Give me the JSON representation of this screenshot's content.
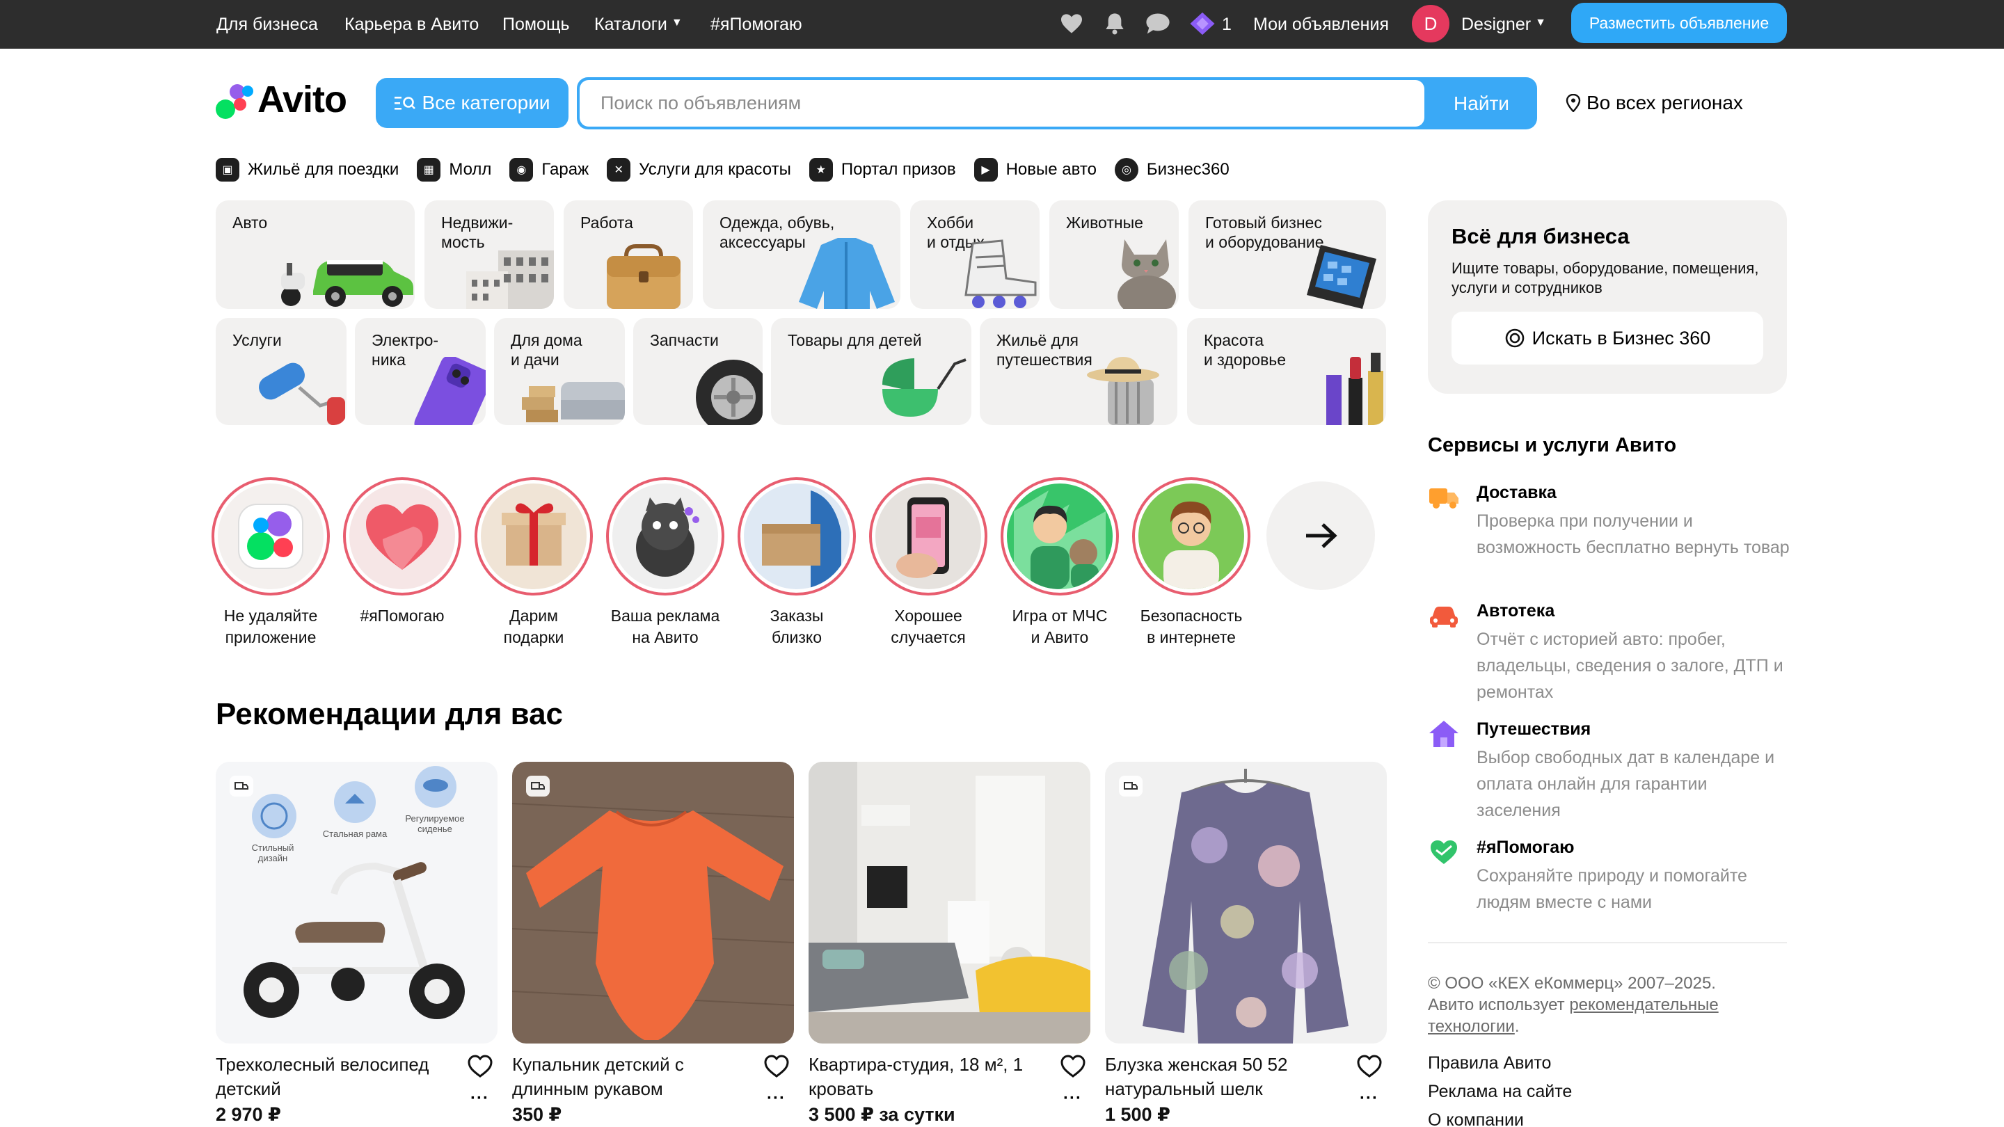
{
  "topbar": {
    "links": [
      "Для бизнеса",
      "Карьера в Авито",
      "Помощь",
      "Каталоги",
      "#яПомогаю"
    ],
    "favorites_icon": "heart-icon",
    "notifications_icon": "bell-icon",
    "messages_icon": "chat-icon",
    "promo_icon": "diamond-icon",
    "promo_count": "1",
    "my_ads": "Мои объявления",
    "avatar_letter": "D",
    "user_name": "Designer",
    "post_ad": "Разместить объявление"
  },
  "header": {
    "logo_text": "Avito",
    "all_categories": "Все категории",
    "search_placeholder": "Поиск по объявлениям",
    "search_button": "Найти",
    "region": "Во всех регионах"
  },
  "quick_links": [
    {
      "label": "Жильё для поездки",
      "icon": "suitcase-icon"
    },
    {
      "label": "Молл",
      "icon": "mall-icon"
    },
    {
      "label": "Гараж",
      "icon": "car-icon"
    },
    {
      "label": "Услуги для красоты",
      "icon": "scissors-icon"
    },
    {
      "label": "Портал призов",
      "icon": "prize-icon"
    },
    {
      "label": "Новые авто",
      "icon": "new-car-icon"
    },
    {
      "label": "Бизнес360",
      "icon": "business360-icon"
    }
  ],
  "categories": [
    {
      "label": "Авто"
    },
    {
      "label": "Недвижи-\nмость"
    },
    {
      "label": "Работа"
    },
    {
      "label": "Одежда, обувь,\nаксессуары"
    },
    {
      "label": "Хобби\nи отдых"
    },
    {
      "label": "Животные"
    },
    {
      "label": "Готовый бизнес\nи оборудование"
    },
    {
      "label": "Услуги"
    },
    {
      "label": "Электро-\nника"
    },
    {
      "label": "Для дома\nи дачи"
    },
    {
      "label": "Запчасти"
    },
    {
      "label": "Товары для детей"
    },
    {
      "label": "Жильё для\nпутешествия"
    },
    {
      "label": "Красота\nи здоровье"
    }
  ],
  "business": {
    "title": "Всё для бизнеса",
    "text": "Ищите товары, оборудование, помещения, услуги и сотрудников",
    "button": "Искать в Бизнес 360"
  },
  "services": {
    "title": "Сервисы и услуги Авито",
    "items": [
      {
        "title": "Доставка",
        "text": "Проверка при получении и возможность бесплатно вернуть товар",
        "icon": "truck-icon",
        "color": "#ff9f2e"
      },
      {
        "title": "Автотека",
        "text": "Отчёт с историей авто: пробег, владельцы, сведения о залоге, ДТП и ремонтах",
        "icon": "car-icon",
        "color": "#f25a3c"
      },
      {
        "title": "Путешествия",
        "text": "Выбор свободных дат в календаре и оплата онлайн для гарантии заселения",
        "icon": "house-icon",
        "color": "#8b5cf6"
      },
      {
        "title": "#яПомогаю",
        "text": "Сохраняйте природу и помогайте людям вместе с нами",
        "icon": "heart-hand-icon",
        "color": "#31c46b"
      }
    ]
  },
  "footer": {
    "copyright": "© ООО «КЕХ еКоммерц» 2007–2025.",
    "tech_prefix": "Авито использует ",
    "tech_link": "рекомендательные технологии",
    "tech_suffix": ".",
    "links": [
      "Правила Авито",
      "Реклама на сайте",
      "О компании"
    ]
  },
  "stories": [
    {
      "label": "Не удаляйте\nприложение"
    },
    {
      "label": "#яПомогаю"
    },
    {
      "label": "Дарим\nподарки"
    },
    {
      "label": "Ваша реклама\nна Авито"
    },
    {
      "label": "Заказы\nблизко"
    },
    {
      "label": "Хорошее\nслучается"
    },
    {
      "label": "Игра от МЧС\nи Авито"
    },
    {
      "label": "Безопасность\nв интернете"
    }
  ],
  "recommendations": {
    "title": "Рекомендации для вас",
    "items": [
      {
        "title": "Трехколесный велосипед детский",
        "price": "2 970 ₽",
        "image_labels": [
          "Стильный дизайн",
          "Стальная рама",
          "Регулируемое сиденье"
        ]
      },
      {
        "title": "Купальник детский с длинным рукавом",
        "price": "350 ₽"
      },
      {
        "title": "Квартира-студия, 18 м², 1 кровать",
        "price": "3 500 ₽ за сутки"
      },
      {
        "title": "Блузка женская 50 52 натуральный шелк",
        "price": "1 500 ₽"
      }
    ]
  },
  "colors": {
    "topbar": "#2d2d2d",
    "accent": "#3aa9f6",
    "story_ring": "#e85d6f",
    "tile_bg": "#f2f1f0"
  }
}
